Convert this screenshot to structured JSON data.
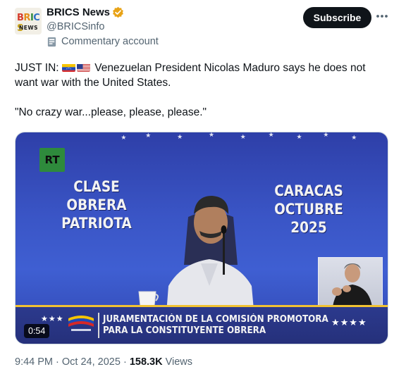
{
  "account": {
    "display_name": "BRICS News",
    "handle": "@BRICSinfo",
    "commentary_label": "Commentary account",
    "avatar_logo_top": "BRICS",
    "avatar_logo_bottom": "NEWS",
    "verified_color": "#e8a317"
  },
  "actions": {
    "subscribe_label": "Subscribe",
    "more_label": "More"
  },
  "tweet": {
    "prefix": "JUST IN:",
    "line1_rest": " Venezuelan President Nicolas Maduro says he does not want war with the United States.",
    "quote": "\"No crazy war...please, please, please.\"",
    "flags": [
      "venezuela-flag",
      "us-flag"
    ]
  },
  "video": {
    "channel_logo": "RT",
    "banner_left": "CLASE OBRERA PATRIOTA",
    "banner_right": "CARACAS OCTUBRE 2025",
    "lower_third_line1": "JURAMENTACIÓN DE LA COMISIÓN PROMOTORA",
    "lower_third_line2": "PARA LA CONSTITUYENTE OBRERA",
    "lower_third_stars_left": "★★★",
    "lower_third_stars_right": "★★★★",
    "duration": "0:54"
  },
  "meta": {
    "time": "9:44 PM",
    "separator": " · ",
    "date": "Oct 24, 2025",
    "views_count": "158.3K",
    "views_label": " Views"
  }
}
